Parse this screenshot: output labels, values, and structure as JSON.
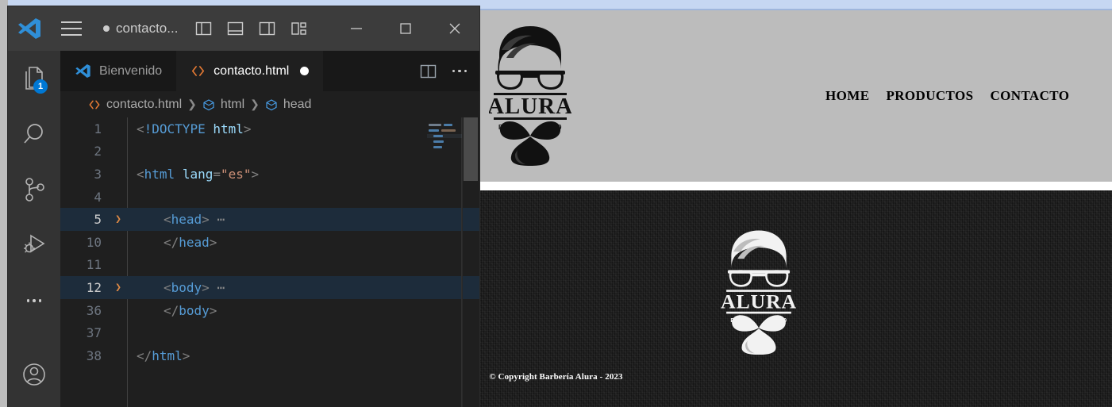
{
  "browser": {
    "page": {
      "header": {
        "logo": {
          "icon": "alura-barber-logo",
          "brand_text": "ALURA",
          "estd_label": "ESTD",
          "year_label": "2020",
          "alt": "Logo Barbería Alura"
        },
        "nav": {
          "items": [
            {
              "label": "HOME"
            },
            {
              "label": "PRODUCTOS"
            },
            {
              "label": "CONTACTO"
            }
          ]
        },
        "background_color": "#bcbcbc"
      },
      "footer": {
        "logo": {
          "icon": "alura-barber-logo-inverted",
          "brand_text": "ALURA",
          "estd_label": "ESTD",
          "year_label": "2020",
          "alt": "Logo Barbería Alura"
        },
        "copyright": "© Copyright Barbería Alura - 2023",
        "background_color": "#1e1e1e",
        "text_color": "#ffffff"
      }
    }
  },
  "vscode": {
    "titlebar": {
      "logo_icon": "vscode-logo-icon",
      "menu_icon": "hamburger-menu-icon",
      "title": "contacto...",
      "dirty_indicator": "●",
      "layout_buttons": [
        {
          "name": "toggle-primary-sidebar",
          "icon": "layout-sidebar-left-icon"
        },
        {
          "name": "toggle-panel",
          "icon": "layout-panel-icon"
        },
        {
          "name": "toggle-secondary-sidebar",
          "icon": "layout-sidebar-right-icon"
        },
        {
          "name": "customize-layout",
          "icon": "layout-customize-icon"
        }
      ],
      "window_controls": [
        {
          "name": "minimize",
          "icon": "minimize-icon",
          "glyph": "—"
        },
        {
          "name": "maximize",
          "icon": "maximize-icon",
          "glyph": "▢"
        },
        {
          "name": "close",
          "icon": "close-icon",
          "glyph": "✕"
        }
      ]
    },
    "activitybar": {
      "items": [
        {
          "name": "explorer",
          "icon": "files-explorer-icon",
          "badge": "1"
        },
        {
          "name": "search",
          "icon": "search-icon",
          "badge": ""
        },
        {
          "name": "source-control",
          "icon": "source-control-branch-icon",
          "badge": ""
        },
        {
          "name": "run-and-debug",
          "icon": "run-debug-icon",
          "badge": ""
        },
        {
          "name": "more-views",
          "icon": "ellipsis-icon",
          "badge": ""
        }
      ],
      "bottom_items": [
        {
          "name": "accounts",
          "icon": "account-person-icon"
        }
      ]
    },
    "tabs": [
      {
        "label": "Bienvenido",
        "icon": "vscode-logo-icon",
        "active": false,
        "dirty": false
      },
      {
        "label": "contacto.html",
        "icon": "html-code-icon",
        "active": true,
        "dirty": true
      }
    ],
    "tabbar_actions": [
      {
        "name": "split-editor-right",
        "icon": "split-editor-icon"
      },
      {
        "name": "more-editor-actions",
        "icon": "ellipsis-icon"
      }
    ],
    "breadcrumb": [
      {
        "label": "contacto.html",
        "icon": "html-code-icon"
      },
      {
        "label": "html",
        "icon": "symbol-field-icon"
      },
      {
        "label": "head",
        "icon": "symbol-field-icon"
      }
    ],
    "editor": {
      "language": "html",
      "lines": [
        {
          "number": "1",
          "folded": false,
          "highlighted": false,
          "indent": 0,
          "tokens": [
            {
              "t": "<",
              "c": "punct"
            },
            {
              "t": "!DOCTYPE",
              "c": "doctype"
            },
            {
              "t": " ",
              "c": "punct"
            },
            {
              "t": "html",
              "c": "name"
            },
            {
              "t": ">",
              "c": "punct"
            }
          ]
        },
        {
          "number": "2",
          "folded": false,
          "highlighted": false,
          "indent": 0,
          "tokens": []
        },
        {
          "number": "3",
          "folded": false,
          "highlighted": false,
          "indent": 0,
          "tokens": [
            {
              "t": "<",
              "c": "punct"
            },
            {
              "t": "html",
              "c": "tag"
            },
            {
              "t": " ",
              "c": "punct"
            },
            {
              "t": "lang",
              "c": "attr"
            },
            {
              "t": "=",
              "c": "punct"
            },
            {
              "t": "\"es\"",
              "c": "str"
            },
            {
              "t": ">",
              "c": "punct"
            }
          ]
        },
        {
          "number": "4",
          "folded": false,
          "highlighted": false,
          "indent": 0,
          "tokens": []
        },
        {
          "number": "5",
          "folded": true,
          "highlighted": true,
          "indent": 1,
          "tokens": [
            {
              "t": "<",
              "c": "punct"
            },
            {
              "t": "head",
              "c": "tag"
            },
            {
              "t": ">",
              "c": "punct"
            },
            {
              "t": " ⋯",
              "c": "ellip"
            }
          ]
        },
        {
          "number": "10",
          "folded": false,
          "highlighted": false,
          "indent": 1,
          "tokens": [
            {
              "t": "</",
              "c": "punct"
            },
            {
              "t": "head",
              "c": "tag"
            },
            {
              "t": ">",
              "c": "punct"
            }
          ]
        },
        {
          "number": "11",
          "folded": false,
          "highlighted": false,
          "indent": 1,
          "tokens": []
        },
        {
          "number": "12",
          "folded": true,
          "highlighted": true,
          "indent": 1,
          "tokens": [
            {
              "t": "<",
              "c": "punct"
            },
            {
              "t": "body",
              "c": "tag"
            },
            {
              "t": ">",
              "c": "punct"
            },
            {
              "t": " ⋯",
              "c": "ellip"
            }
          ]
        },
        {
          "number": "36",
          "folded": false,
          "highlighted": false,
          "indent": 1,
          "tokens": [
            {
              "t": "</",
              "c": "punct"
            },
            {
              "t": "body",
              "c": "tag"
            },
            {
              "t": ">",
              "c": "punct"
            }
          ]
        },
        {
          "number": "37",
          "folded": false,
          "highlighted": false,
          "indent": 1,
          "tokens": []
        },
        {
          "number": "38",
          "folded": false,
          "highlighted": false,
          "indent": 0,
          "tokens": [
            {
              "t": "</",
              "c": "punct"
            },
            {
              "t": "html",
              "c": "tag"
            },
            {
              "t": ">",
              "c": "punct"
            }
          ]
        }
      ]
    },
    "colors": {
      "titlebar_bg": "#3c3c3c",
      "activitybar_bg": "#333333",
      "editor_bg": "#1f1f1f",
      "tabbar_bg": "#181818",
      "fold_highlight": "#1d2c3b",
      "badge_bg": "#0078d4",
      "accent_orange": "#e37933",
      "tag_blue": "#569cd6",
      "string_orange": "#ce9178"
    }
  }
}
